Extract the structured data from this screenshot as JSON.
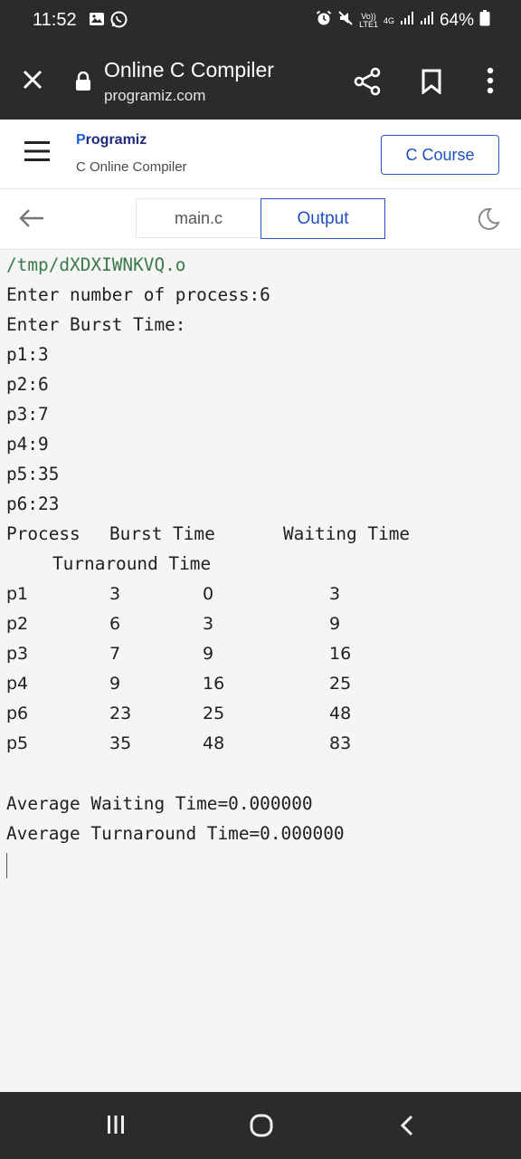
{
  "status_bar": {
    "time": "11:52",
    "battery": "64%",
    "network_top": "Vo))",
    "network_bottom": "LTE1",
    "network_gen": "4G"
  },
  "browser": {
    "title": "Online C Compiler",
    "url": "programiz.com"
  },
  "site": {
    "logo": "Programiz",
    "subtitle": "C Online Compiler",
    "course_button": "C Course"
  },
  "tabs": {
    "main": "main.c",
    "output": "Output"
  },
  "console": {
    "lines": [
      "/tmp/dXDXIWNKVQ.o",
      "Enter number of process:6",
      "Enter Burst Time:",
      "p1:3",
      "p2:6",
      "p3:7",
      "p4:9",
      "p5:35",
      "p6:23"
    ],
    "header": {
      "process": "Process",
      "burst": "Burst Time",
      "waiting": "Waiting Time",
      "turnaround": "Turnaround Time"
    },
    "rows": [
      [
        "p1",
        "3",
        "0",
        "3"
      ],
      [
        "p2",
        "6",
        "3",
        "9"
      ],
      [
        "p3",
        "7",
        "9",
        "16"
      ],
      [
        "p4",
        "9",
        "16",
        "25"
      ],
      [
        "p6",
        "23",
        "25",
        "48"
      ],
      [
        "p5",
        "35",
        "48",
        "83"
      ]
    ],
    "avg_waiting": "Average Waiting Time=0.000000",
    "avg_turnaround": "Average Turnaround Time=0.000000"
  }
}
